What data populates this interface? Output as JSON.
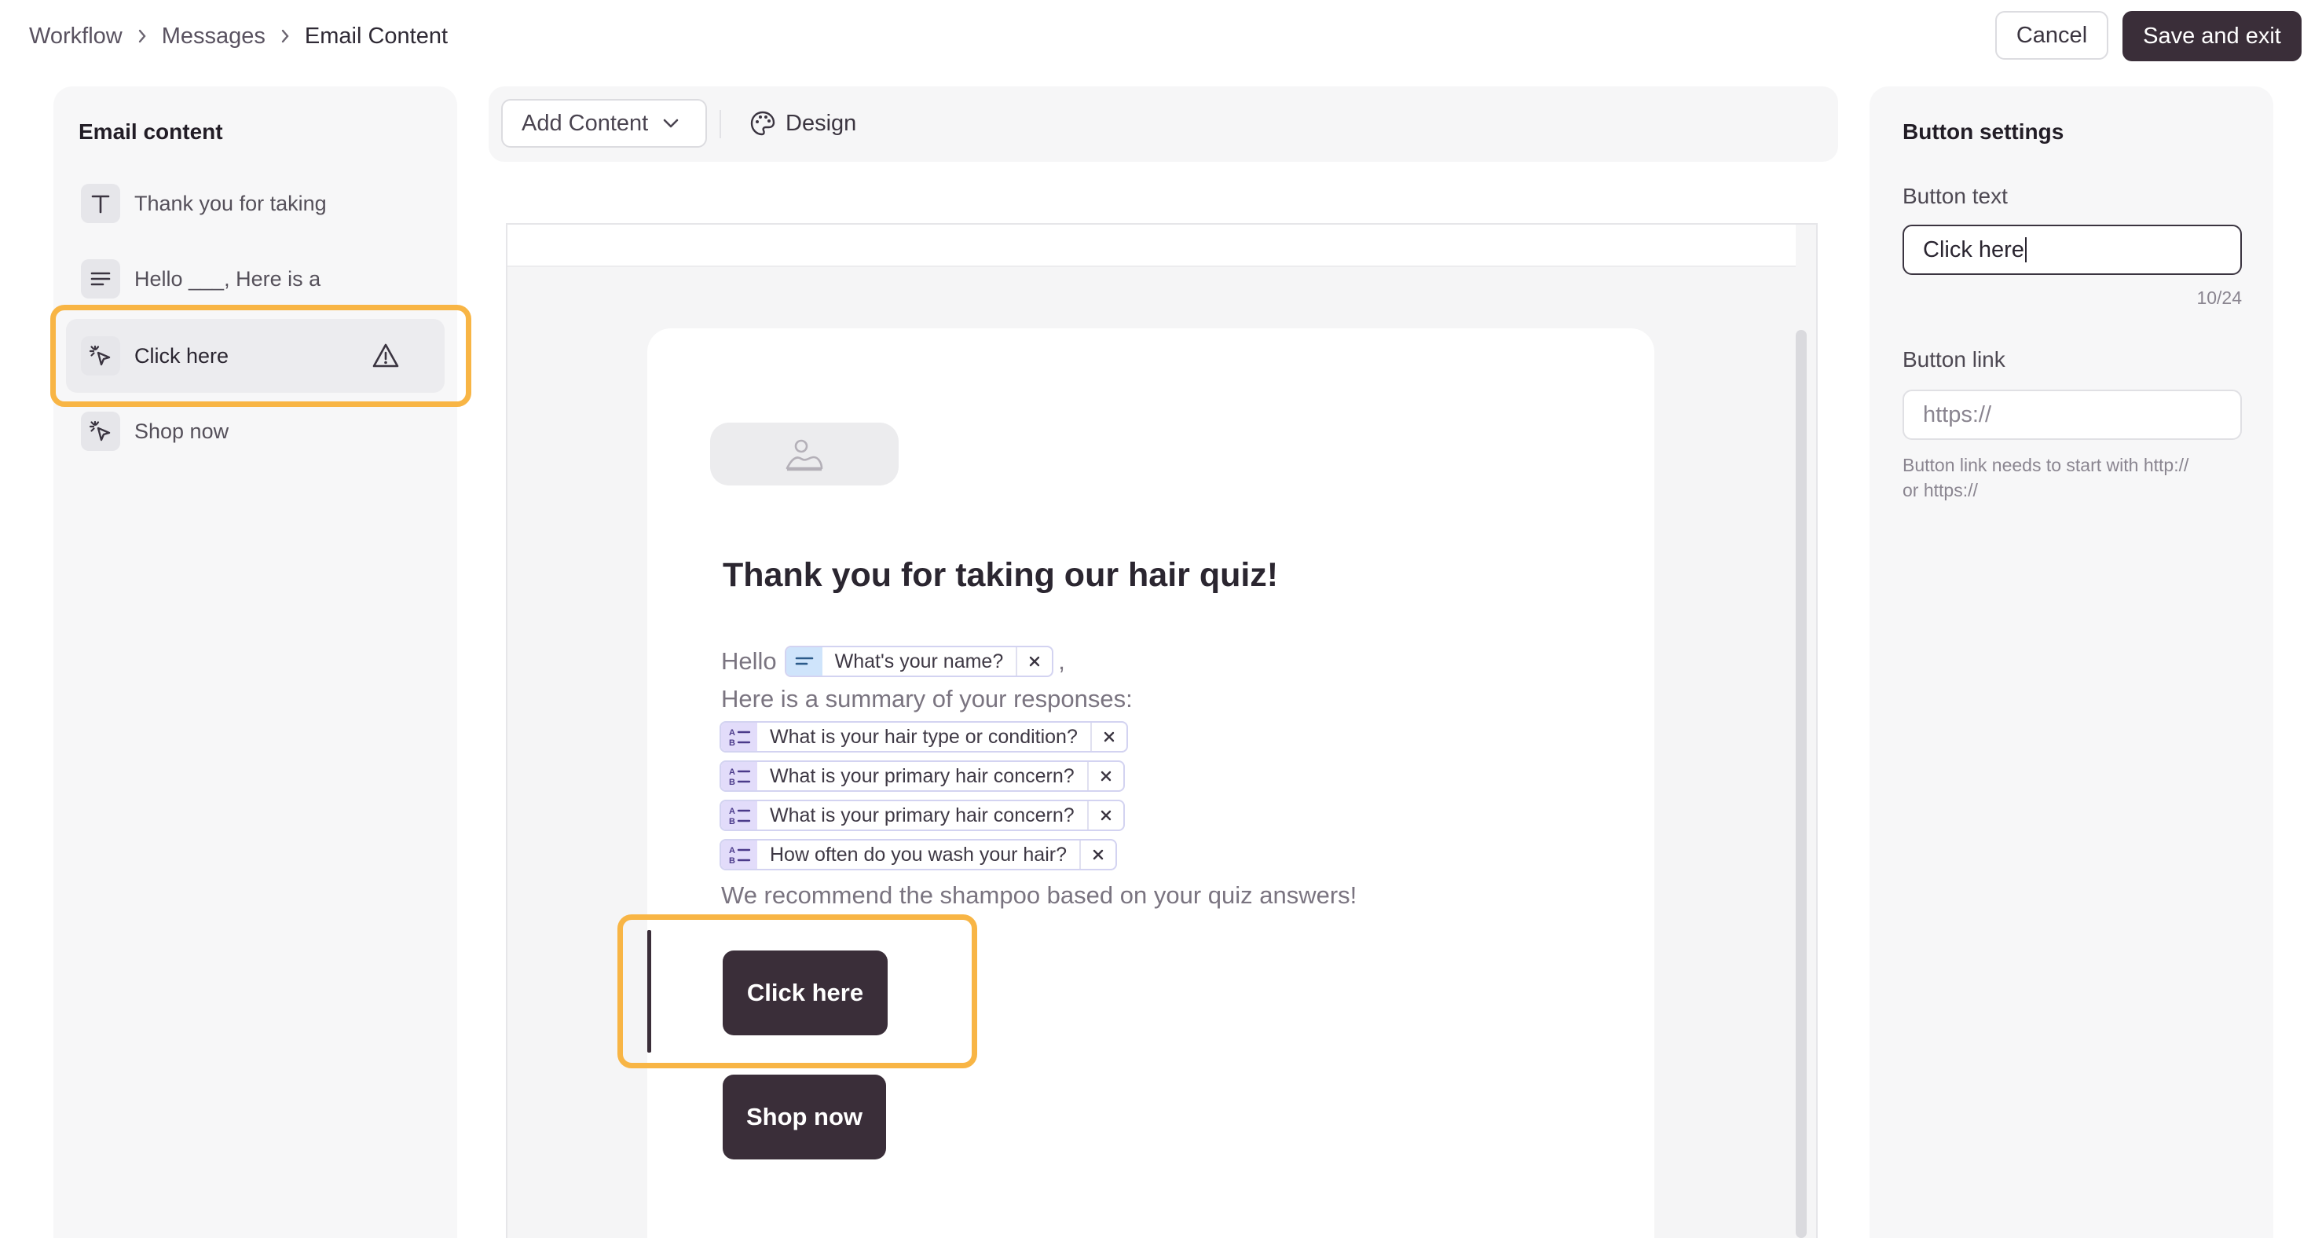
{
  "breadcrumb": [
    "Workflow",
    "Messages",
    "Email Content"
  ],
  "header": {
    "cancel_label": "Cancel",
    "save_label": "Save and exit"
  },
  "left_panel": {
    "title": "Email content",
    "items": [
      {
        "icon": "text-type-icon",
        "label": "Thank you for taking"
      },
      {
        "icon": "paragraph-icon",
        "label": "Hello ___, Here is a"
      },
      {
        "icon": "button-click-icon",
        "label": "Click here",
        "selected": true,
        "warning": true
      },
      {
        "icon": "button-click-icon",
        "label": "Shop now"
      }
    ]
  },
  "toolbar": {
    "add_content_label": "Add Content",
    "design_label": "Design"
  },
  "email": {
    "title": "Thank you for taking our hair quiz!",
    "hello": "Hello",
    "comma": ",",
    "name_chip": "What's your name?",
    "summary_text": "Here is a summary of your responses:",
    "response_chips": [
      "What is your hair type or condition?",
      "What is your primary hair concern?",
      "What is your primary hair concern?",
      "How often do you wash your hair?"
    ],
    "recommend_text": "We recommend the shampoo based on your quiz answers!",
    "button_1": "Click here",
    "button_2": "Shop now"
  },
  "right_panel": {
    "title": "Button settings",
    "button_text_label": "Button text",
    "button_text_value": "Click here",
    "counter": "10/24",
    "button_link_label": "Button link",
    "button_link_placeholder": "https://",
    "help_line_1": "Button link needs to start with http://",
    "help_line_2": "or https://"
  },
  "colors": {
    "accent": "#3a2e39",
    "highlight": "#f8b545",
    "chip_purple": "#e2dcfa",
    "chip_blue": "#cfe4fb"
  }
}
